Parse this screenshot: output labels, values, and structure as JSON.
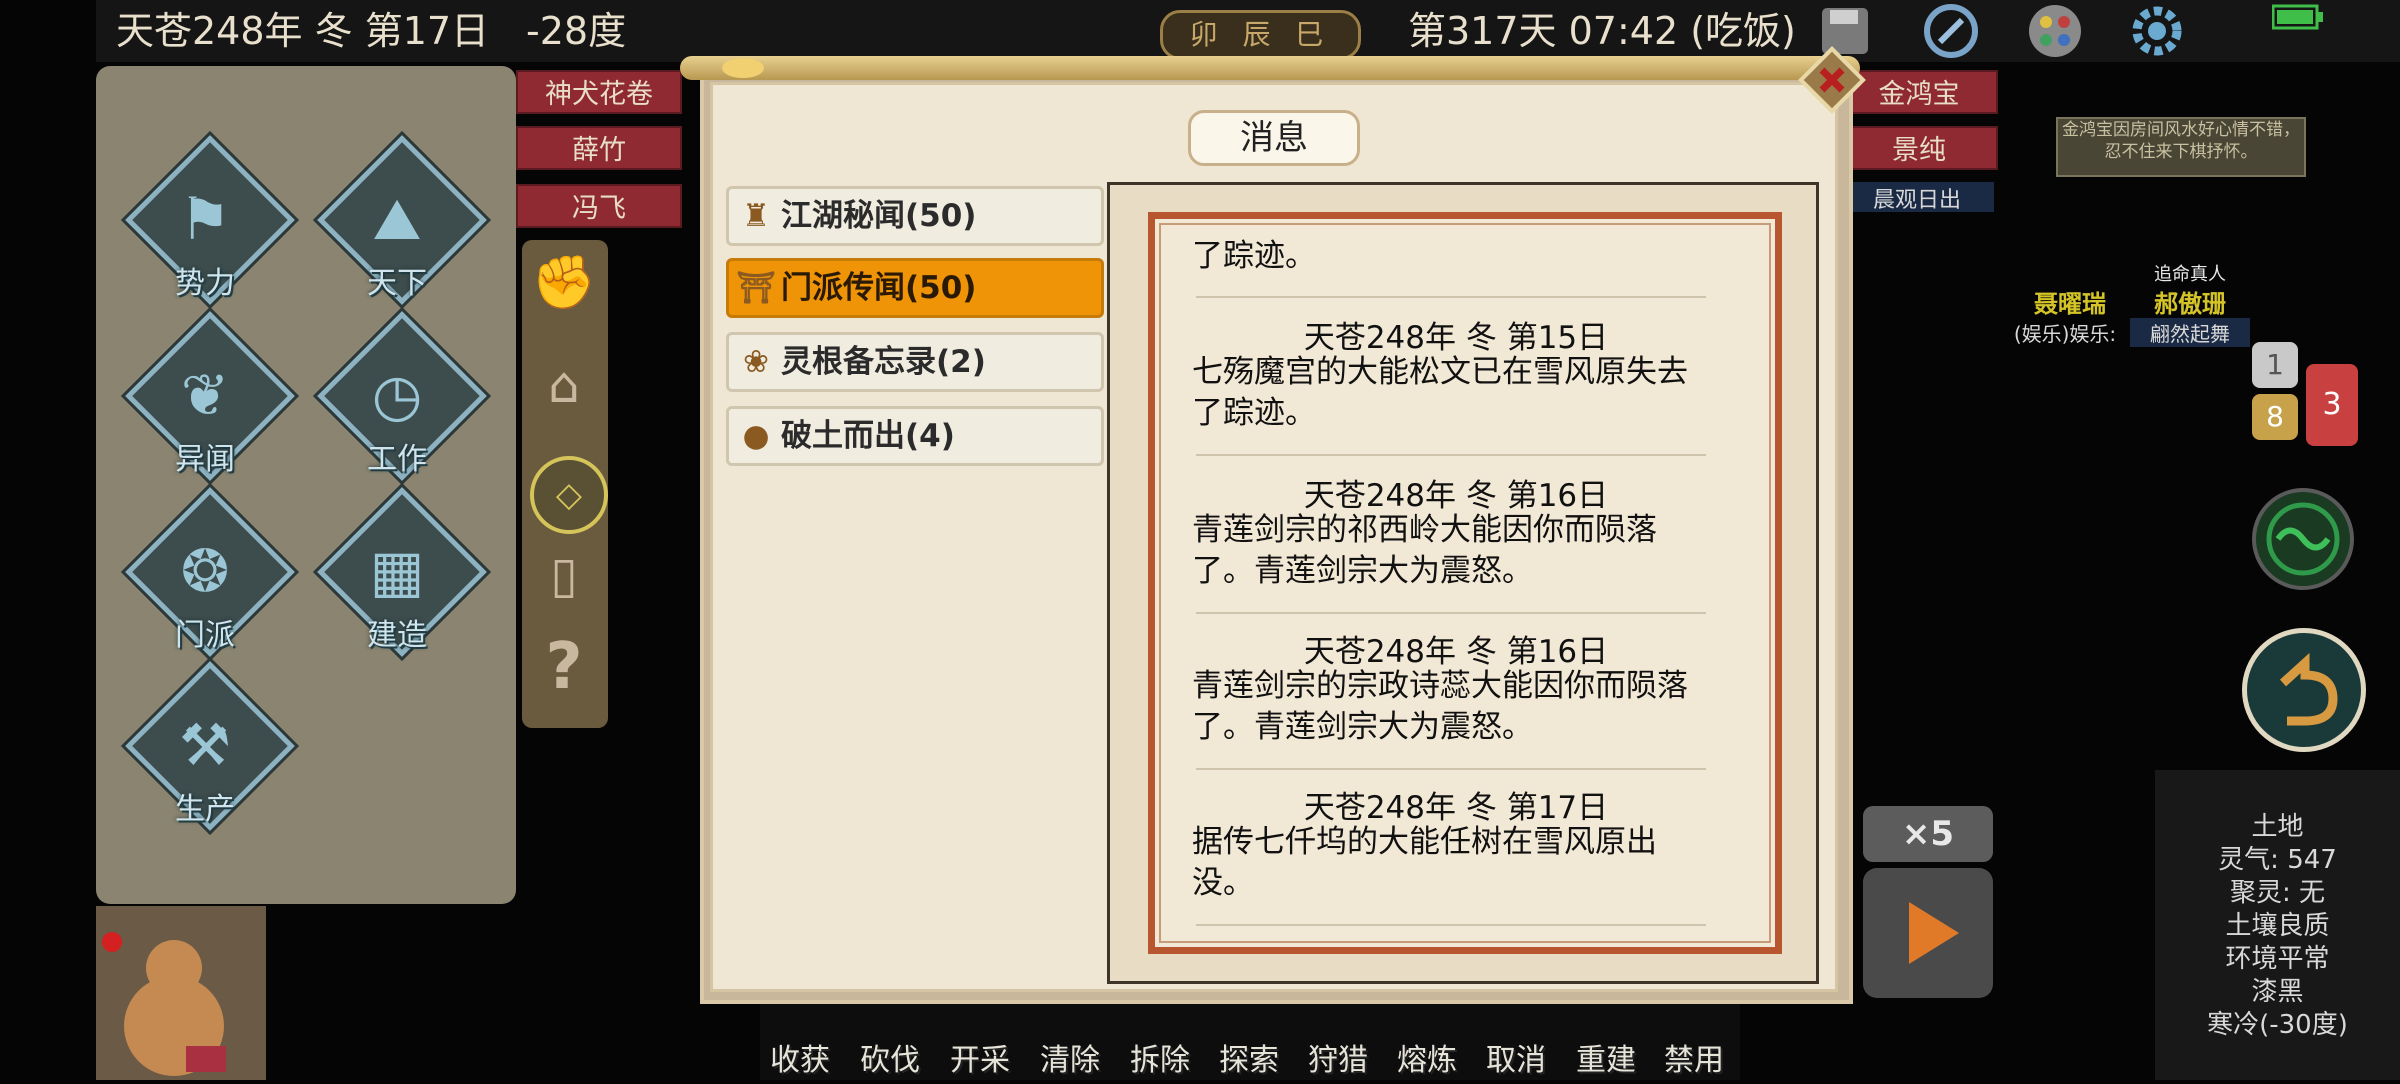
{
  "topbar": {
    "date": "天苍248年 冬 第17日",
    "temperature": "-28度",
    "time_slots": "卯 辰 巳",
    "day_time": "第317天 07:42 (吃饭)"
  },
  "left_menu": {
    "items": [
      {
        "label": "势力",
        "icon": "flag-icon"
      },
      {
        "label": "天下",
        "icon": "world-map-icon"
      },
      {
        "label": "异闻",
        "icon": "butterfly-icon"
      },
      {
        "label": "工作",
        "icon": "clock-icon"
      },
      {
        "label": "门派",
        "icon": "snail-shell-icon"
      },
      {
        "label": "建造",
        "icon": "building-icon"
      },
      {
        "label": "生产",
        "icon": "hammer-icon"
      }
    ]
  },
  "characters": {
    "left": [
      "神犬花卷",
      "薛竹",
      "冯飞"
    ],
    "right": [
      "金鸿宝",
      "景纯"
    ],
    "right_status": "晨观日出"
  },
  "dialog": {
    "title": "消息",
    "tabs": [
      {
        "label": "江湖秘闻(50)",
        "active": false
      },
      {
        "label": "门派传闻(50)",
        "active": true
      },
      {
        "label": "灵根备忘录(2)",
        "active": false
      },
      {
        "label": "破土而出(4)",
        "active": false
      }
    ],
    "messages": [
      {
        "date": "",
        "body": "了踪迹。"
      },
      {
        "date": "天苍248年 冬 第15日",
        "body": "七殇魔宫的大能松文已在雪风原失去了踪迹。"
      },
      {
        "date": "天苍248年 冬 第16日",
        "body": "青莲剑宗的祁西岭大能因你而陨落了。青莲剑宗大为震怒。"
      },
      {
        "date": "天苍248年 冬 第16日",
        "body": "青莲剑宗的宗政诗蕊大能因你而陨落了。青莲剑宗大为震怒。"
      },
      {
        "date": "天苍248年 冬 第17日",
        "body": "据传七仟坞的大能任树在雪风原出没。"
      }
    ]
  },
  "toolbar": {
    "actions": [
      "收获",
      "砍伐",
      "开采",
      "清除",
      "拆除",
      "探索",
      "狩猎",
      "熔炼",
      "取消",
      "重建",
      "禁用"
    ]
  },
  "right_side": {
    "notification": "金鸿宝因房间风水好心情不错，忍不住来下棋抒怀。",
    "npc_title": "追命真人",
    "npc_names": [
      "聂曜瑞",
      "郝傲珊"
    ],
    "npc_activity": "(娱乐)娱乐:",
    "npc_activity_right": "翩然起舞",
    "badges": [
      "1",
      "8",
      "3"
    ],
    "speed": "×5"
  },
  "tile_info": {
    "lines": [
      "土地",
      "灵气: 547",
      "聚灵: 无",
      "土壤良质",
      "环境平常",
      "漆黑",
      "寒冷(-30度)"
    ]
  },
  "colors": {
    "accent_orange": "#ef9307",
    "strip_red": "#8f2a32",
    "parchment": "#f2e8d6",
    "border_red": "#b7562f"
  }
}
